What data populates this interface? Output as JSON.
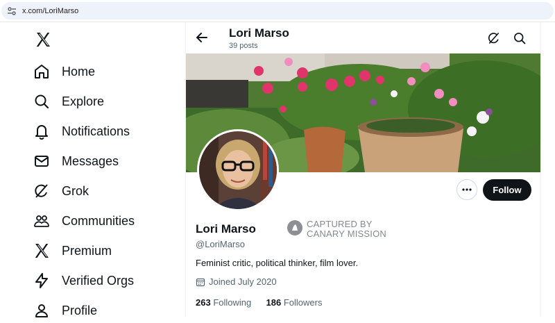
{
  "browser": {
    "url": "x.com/LoriMarso"
  },
  "nav": {
    "items": [
      {
        "label": "Home",
        "icon": "home-icon"
      },
      {
        "label": "Explore",
        "icon": "search-icon"
      },
      {
        "label": "Notifications",
        "icon": "bell-icon"
      },
      {
        "label": "Messages",
        "icon": "envelope-icon"
      },
      {
        "label": "Grok",
        "icon": "grok-icon"
      },
      {
        "label": "Communities",
        "icon": "communities-icon"
      },
      {
        "label": "Premium",
        "icon": "x-logo-icon"
      },
      {
        "label": "Verified Orgs",
        "icon": "lightning-icon"
      },
      {
        "label": "Profile",
        "icon": "person-icon"
      }
    ]
  },
  "header": {
    "title": "Lori Marso",
    "post_count": "39 posts"
  },
  "profile": {
    "name": "Lori Marso",
    "handle": "@LoriMarso",
    "bio": "Feminist critic, political thinker, film lover.",
    "joined": "Joined July 2020",
    "following_count": "263",
    "following_label": "Following",
    "followers_count": "186",
    "followers_label": "Followers",
    "follow_label": "Follow"
  },
  "watermark": {
    "line1": "CAPTURED BY",
    "line2": "CANARY MISSION"
  },
  "colors": {
    "text": "#0f1419",
    "muted": "#536471",
    "button": "#0f1419"
  }
}
